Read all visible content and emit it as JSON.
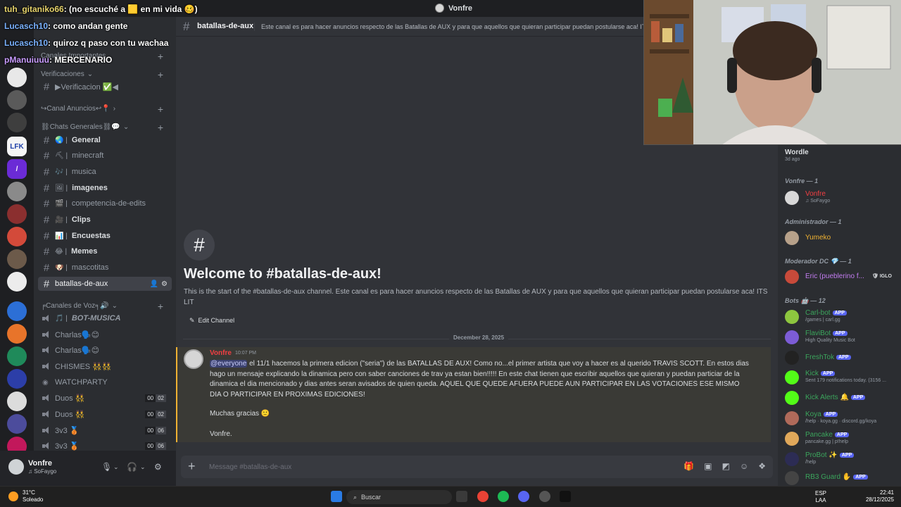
{
  "window": {
    "title": "Vonfre"
  },
  "overlay_chat": [
    {
      "user": "tuh_gitaniko66",
      "text": ": (no escuché a 🟨 en mi vida 🥴)"
    },
    {
      "user": "Lucasch10",
      "text": ": como andan gente"
    },
    {
      "user": "Lucasch10",
      "text": ": quiroz q paso con tu wachaa"
    },
    {
      "user": "pManuiuuu",
      "text": ": MERCENARIO"
    }
  ],
  "sidebar": {
    "categories": {
      "importantes": "Canales Importantes",
      "verificaciones": "Verificaciones",
      "anuncios": "↪Canal Anuncios↩📍",
      "generales": "⛓Chats Generales⛓💬",
      "voz": "╒Canales de Voz╕🔊"
    },
    "channels": [
      {
        "name": "▶Verificacion ✅◀",
        "emoji": ""
      },
      {
        "name": "General",
        "emoji": "🌏 |"
      },
      {
        "name": "minecraft",
        "emoji": "⛏ |"
      },
      {
        "name": "musica",
        "emoji": "🎶 |"
      },
      {
        "name": "imagenes",
        "emoji": "🖼 |"
      },
      {
        "name": "competencia-de-edits",
        "emoji": "🎬 |"
      },
      {
        "name": "Clips",
        "emoji": "🎥 |"
      },
      {
        "name": "Encuestas",
        "emoji": "📊 |"
      },
      {
        "name": "Memes",
        "emoji": "😂 |"
      },
      {
        "name": "mascotitas",
        "emoji": "🐶 |"
      },
      {
        "name": "batallas-de-aux",
        "emoji": ""
      }
    ],
    "voice": [
      {
        "name": "BOT-MUSICA",
        "emoji": "🎵 |",
        "count": ""
      },
      {
        "name": "Charlas🗣️😊",
        "emoji": "",
        "count": ""
      },
      {
        "name": "Charlas🗣️😊",
        "emoji": "",
        "count": ""
      },
      {
        "name": "CHISMES 👯‍♀️👯",
        "emoji": "",
        "count": ""
      },
      {
        "name": "WATCHPARTY",
        "emoji": "",
        "count": ""
      },
      {
        "name": "Duos 👯",
        "emoji": "",
        "count_a": "00",
        "count_b": "02"
      },
      {
        "name": "Duos 👯",
        "emoji": "",
        "count_a": "00",
        "count_b": "02"
      },
      {
        "name": "3v3 🥉",
        "emoji": "",
        "count_a": "00",
        "count_b": "06"
      },
      {
        "name": "3v3 🥉",
        "emoji": "",
        "count_a": "00",
        "count_b": "06"
      }
    ]
  },
  "user_panel": {
    "name": "Vonfre",
    "status": "♫ SoFaygo"
  },
  "main": {
    "channel_name": "batallas-de-aux",
    "topic": "Este canal es para hacer anuncios respecto de las Batallas de AUX y para que aquellos que quieran participar puedan postularse aca! ITS LIT",
    "welcome_title": "Welcome to #batallas-de-aux!",
    "welcome_desc": "This is the start of the #batallas-de-aux channel. Este canal es para hacer anuncios respecto de las Batallas de AUX y para que aquellos que quieran participar puedan postularse aca! ITS LIT",
    "edit_channel": "Edit Channel",
    "date": "December 28, 2025",
    "message": {
      "author": "Vonfre",
      "time": "10:07 PM",
      "mention": "@everyone",
      "text": " el 11/1 hacemos la primera edicion (\"seria\") de las BATALLAS DE AUX! Como no...el primer artista que voy a hacer es al querido TRAVIS SCOTT. En estos dias hago un mensaje explicando la dinamica pero con saber canciones de trav ya estan bien!!!!! En este chat tienen que escribir aquellos que quieran y puedan particiar de la dinamica el dia mencionado y dias antes seran avisados de quien queda. AQUEL QUE QUEDE AFUERA PUEDE AUN PARTICIPAR EN LAS VOTACIONES ESE MISMO DIA O PARTICIPAR EN PROXIMAS EDICIONES!",
      "thanks": "Muchas gracias 🙂",
      "sign": "Vonfre."
    },
    "composer_placeholder": "Message #batallas-de-aux"
  },
  "members": {
    "wordle": {
      "name": "Wordle",
      "sub": "3d ago"
    },
    "groups": [
      {
        "title": "Vonfre — 1"
      },
      {
        "title": "Administrador — 1"
      },
      {
        "title": "Moderador DC 💎 — 1"
      },
      {
        "title": "Bots 🤖 — 12"
      }
    ],
    "list": [
      {
        "name": "Vonfre",
        "sub": "♫ SoFaygo",
        "color": "#f23f43",
        "av": "#d8d8d8"
      },
      {
        "name": "Yumeko",
        "sub": "",
        "color": "#f0b232",
        "av": "#b7a18a"
      },
      {
        "name": "Eric (pueblerino f...",
        "sub": "",
        "color": "#c27cf0",
        "av": "#c84a3a",
        "tag": "🛡 IGLO"
      },
      {
        "name": "Carl-bot",
        "sub": "/games | carl.gg",
        "color": "#3ba55c",
        "av": "#8dc63f",
        "app": "APP"
      },
      {
        "name": "FlaviBot",
        "sub": "High Quality Music Bot",
        "color": "#3ba55c",
        "av": "#7c5cd6",
        "app": "APP"
      },
      {
        "name": "FreshTok",
        "sub": "",
        "color": "#3ba55c",
        "av": "#222222",
        "app": "APP"
      },
      {
        "name": "Kick",
        "sub": "Sent 179 notifications today. (3156 ...",
        "color": "#3ba55c",
        "av": "#53fc18",
        "app": "APP"
      },
      {
        "name": "Kick Alerts 🔔",
        "sub": "",
        "color": "#3ba55c",
        "av": "#53fc18",
        "app": "APP"
      },
      {
        "name": "Koya",
        "sub": "/help · koya.gg · discord.gg/koya",
        "color": "#3ba55c",
        "av": "#b06a5a",
        "app": "APP"
      },
      {
        "name": "Pancake",
        "sub": "pancake.gg | p!help",
        "color": "#3ba55c",
        "av": "#e0a85a",
        "app": "APP"
      },
      {
        "name": "ProBot ✨",
        "sub": "/help",
        "color": "#3ba55c",
        "av": "#2c2c54",
        "app": "APP"
      },
      {
        "name": "RB3 Guard ✋",
        "sub": "",
        "color": "#3ba55c",
        "av": "#444444",
        "app": "APP"
      }
    ]
  },
  "taskbar": {
    "temp": "31°C",
    "weather": "Soleado",
    "search": "Buscar",
    "lang_a": "ESP",
    "lang_b": "LAA",
    "time": "22:41",
    "date": "28/12/2025"
  }
}
